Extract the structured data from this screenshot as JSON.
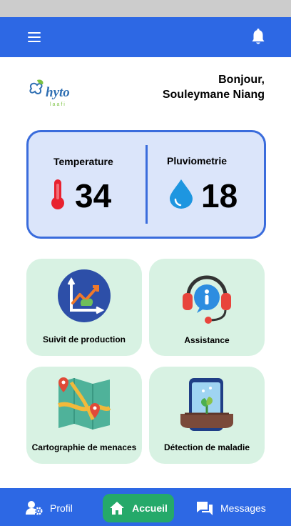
{
  "header": {
    "menu_icon": "hamburger-menu-icon",
    "notification_icon": "bell-icon"
  },
  "logo": {
    "name": "hyto",
    "tagline": "laafi"
  },
  "greeting": {
    "line1": "Bonjour,",
    "line2": "Souleymane Niang"
  },
  "weather": {
    "temperature_label": "Temperature",
    "temperature_value": "34",
    "temperature_icon": "thermometer-icon",
    "rain_label": "Pluviometrie",
    "rain_value": "18",
    "rain_icon": "water-drop-icon"
  },
  "cards": [
    {
      "label": "Suivit de production",
      "icon": "growth-chart-icon"
    },
    {
      "label": "Assistance",
      "icon": "headset-support-icon"
    },
    {
      "label": "Cartographie de menaces",
      "icon": "map-pins-icon"
    },
    {
      "label": "Détection de maladie",
      "icon": "phone-plant-scan-icon"
    }
  ],
  "nav": [
    {
      "label": "Profil",
      "icon": "user-settings-icon"
    },
    {
      "label": "Accueil",
      "icon": "home-icon",
      "active": true
    },
    {
      "label": "Messages",
      "icon": "chat-icon"
    }
  ],
  "colors": {
    "primary": "#2d68e4",
    "card_bg": "#d8f2e3",
    "weather_bg": "#dbe5fa",
    "active_nav": "#25a96a"
  }
}
